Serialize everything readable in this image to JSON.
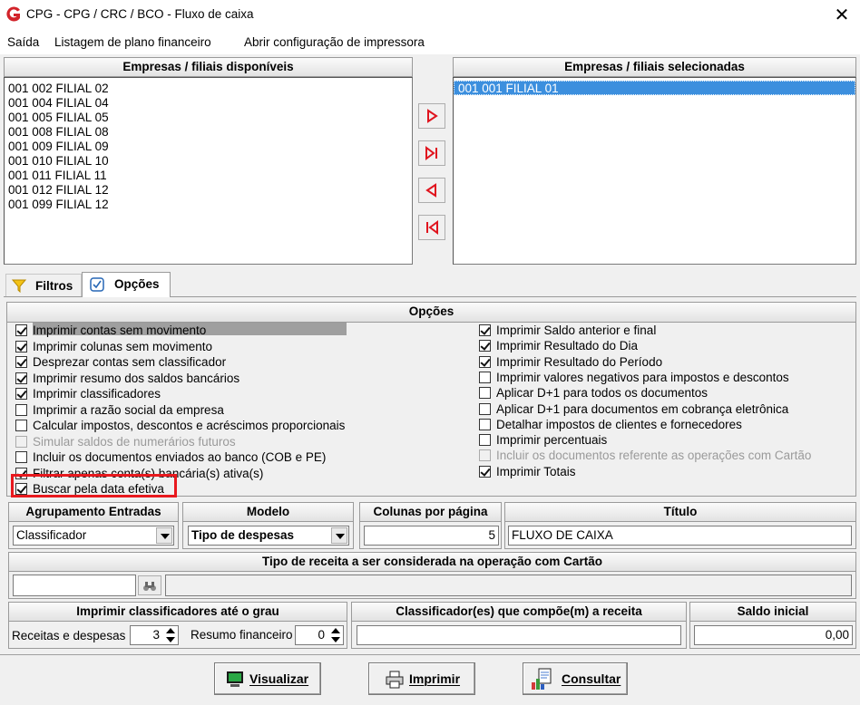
{
  "window": {
    "title": "CPG - CPG / CRC / BCO - Fluxo de caixa",
    "close_glyph": "✕",
    "logo_icon": "app-logo-icon"
  },
  "menu": [
    "Saída",
    "Listagem de plano financeiro",
    "Abrir configuração de impressora"
  ],
  "available": {
    "header": "Empresas / filiais disponíveis",
    "items": [
      "001 002 FILIAL 02",
      "001 004 FILIAL 04",
      "001 005 FILIAL 05",
      "001 008 FILIAL 08",
      "001 009 FILIAL 09",
      "001 010 FILIAL 10",
      "001 011 FILIAL 11",
      "001 012 FILIAL 12",
      "001 099 FILIAL 12"
    ]
  },
  "selected": {
    "header": "Empresas / filiais selecionadas",
    "items": [
      "001 001 FILIAL 01"
    ]
  },
  "tabs": {
    "filtros": "Filtros",
    "opcoes": "Opções"
  },
  "options": {
    "header": "Opções",
    "left": [
      {
        "label": "Imprimir contas sem movimento",
        "checked": true,
        "enabled": true
      },
      {
        "label": "Imprimir colunas sem movimento",
        "checked": true,
        "enabled": true
      },
      {
        "label": "Desprezar contas sem  classificador",
        "checked": true,
        "enabled": true
      },
      {
        "label": "Imprimir resumo dos saldos bancários",
        "checked": true,
        "enabled": true
      },
      {
        "label": "Imprimir classificadores",
        "checked": true,
        "enabled": true
      },
      {
        "label": "Imprimir a razão social da empresa",
        "checked": false,
        "enabled": true
      },
      {
        "label": "Calcular impostos, descontos e acréscimos proporcionais",
        "checked": false,
        "enabled": true
      },
      {
        "label": "Simular saldos de numerários futuros",
        "checked": false,
        "enabled": false
      },
      {
        "label": "Incluir os documentos enviados ao banco (COB e PE)",
        "checked": false,
        "enabled": true
      },
      {
        "label": "Filtrar apenas conta(s) bancária(s) ativa(s)",
        "checked": true,
        "enabled": true
      },
      {
        "label": "Buscar pela data efetiva",
        "checked": true,
        "enabled": true
      }
    ],
    "right": [
      {
        "label": "Imprimir Saldo anterior e final",
        "checked": true,
        "enabled": true
      },
      {
        "label": "Imprimir Resultado do Dia",
        "checked": true,
        "enabled": true
      },
      {
        "label": "Imprimir Resultado do Período",
        "checked": true,
        "enabled": true
      },
      {
        "label": "Imprimir valores negativos para impostos e descontos",
        "checked": false,
        "enabled": true
      },
      {
        "label": "Aplicar D+1 para todos os documentos",
        "checked": false,
        "enabled": true
      },
      {
        "label": "Aplicar D+1 para documentos em cobrança eletrônica",
        "checked": false,
        "enabled": true
      },
      {
        "label": "Detalhar impostos de clientes e fornecedores",
        "checked": false,
        "enabled": true
      },
      {
        "label": "Imprimir percentuais",
        "checked": false,
        "enabled": true
      },
      {
        "label": "Incluir os documentos referente as operações com Cartão",
        "checked": false,
        "enabled": false
      },
      {
        "label": "Imprimir Totais",
        "checked": true,
        "enabled": true
      }
    ],
    "highlight_color": "#e8191e"
  },
  "agrupamento": {
    "header": "Agrupamento Entradas",
    "value": "Classificador"
  },
  "modelo": {
    "header": "Modelo",
    "value": "Tipo de despesas"
  },
  "colunas": {
    "header": "Colunas por página",
    "value": "5"
  },
  "titulo": {
    "header": "Título",
    "value": "FLUXO DE CAIXA"
  },
  "tipo_receita": {
    "header": "Tipo de receita a ser considerada na operação com Cartão",
    "code": "",
    "description": ""
  },
  "grau": {
    "header": "Imprimir classificadores até o grau",
    "receitas_label": "Receitas e despesas",
    "receitas_value": "3",
    "resumo_label": "Resumo financeiro",
    "resumo_value": "0"
  },
  "classificadores": {
    "header": "Classificador(es) que compõe(m) a receita",
    "value": ""
  },
  "saldo": {
    "header": "Saldo inicial",
    "value": "0,00"
  },
  "buttons": {
    "visualizar": "Visualizar",
    "imprimir": "Imprimir",
    "consultar": "Consultar"
  }
}
